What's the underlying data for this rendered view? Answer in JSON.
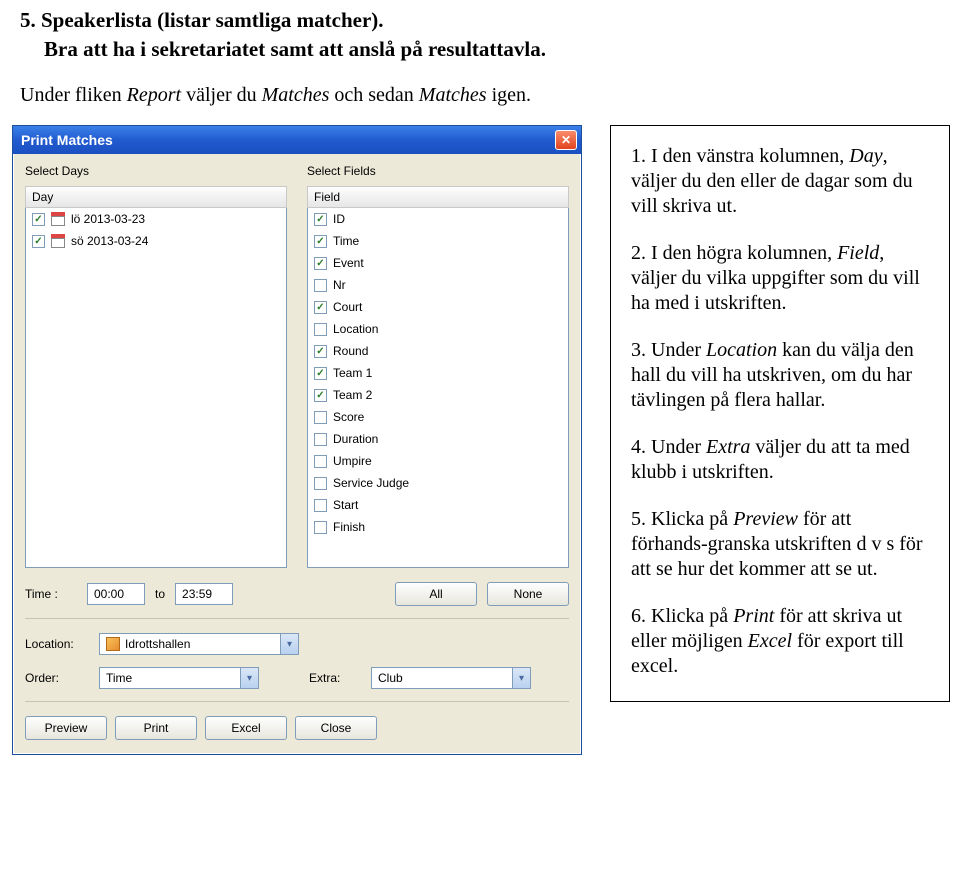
{
  "doc": {
    "heading": "5. Speakerlista (listar samtliga matcher).",
    "subheading": "Bra att ha i sekretariatet samt att anslå på resultattavla.",
    "intro_prefix": "Under fliken ",
    "intro_italic1": "Report",
    "intro_mid": " väljer du ",
    "intro_italic2": "Matches",
    "intro_mid2": " och sedan ",
    "intro_italic3": "Matches",
    "intro_suffix": " igen."
  },
  "window": {
    "title": "Print Matches",
    "left": {
      "label": "Select Days",
      "header": "Day",
      "items": [
        {
          "checked": true,
          "text": "lö 2013-03-23"
        },
        {
          "checked": true,
          "text": "sö 2013-03-24"
        }
      ]
    },
    "right": {
      "label": "Select Fields",
      "header": "Field",
      "items": [
        {
          "checked": true,
          "text": "ID"
        },
        {
          "checked": true,
          "text": "Time"
        },
        {
          "checked": true,
          "text": "Event"
        },
        {
          "checked": false,
          "text": "Nr"
        },
        {
          "checked": true,
          "text": "Court"
        },
        {
          "checked": false,
          "text": "Location"
        },
        {
          "checked": true,
          "text": "Round"
        },
        {
          "checked": true,
          "text": "Team 1"
        },
        {
          "checked": true,
          "text": "Team 2"
        },
        {
          "checked": false,
          "text": "Score"
        },
        {
          "checked": false,
          "text": "Duration"
        },
        {
          "checked": false,
          "text": "Umpire"
        },
        {
          "checked": false,
          "text": "Service Judge"
        },
        {
          "checked": false,
          "text": "Start"
        },
        {
          "checked": false,
          "text": "Finish"
        }
      ]
    },
    "time": {
      "label": "Time :",
      "from": "00:00",
      "to_label": "to",
      "to": "23:59",
      "all_btn": "All",
      "none_btn": "None"
    },
    "location": {
      "label": "Location:",
      "value": "Idrottshallen"
    },
    "order": {
      "label": "Order:",
      "value": "Time"
    },
    "extra": {
      "label": "Extra:",
      "value": "Club"
    },
    "buttons": {
      "preview": "Preview",
      "print": "Print",
      "excel": "Excel",
      "close": "Close"
    }
  },
  "notes": {
    "n1a": "1. I den vänstra kolumnen, ",
    "n1i": "Day",
    "n1b": ", väljer du den eller de dagar som du vill skriva ut.",
    "n2a": "2. I den högra kolumnen, ",
    "n2i": "Field",
    "n2b": ", väljer du vilka uppgifter som du vill ha med i utskriften.",
    "n3a": "3. Under ",
    "n3i": "Location",
    "n3b": " kan du välja den hall du vill ha utskriven, om du har tävlingen på flera hallar.",
    "n4a": "4. Under ",
    "n4i": "Extra",
    "n4b": " väljer du att ta med klubb i utskriften.",
    "n5a": "5. Klicka på ",
    "n5i": "Preview",
    "n5b": " för att förhands-granska utskriften d v s för att se hur det kommer att se ut.",
    "n6a": "6. Klicka på ",
    "n6i": "Print",
    "n6b": " för att skriva ut eller möjligen ",
    "n6i2": "Excel",
    "n6c": " för export till excel."
  }
}
